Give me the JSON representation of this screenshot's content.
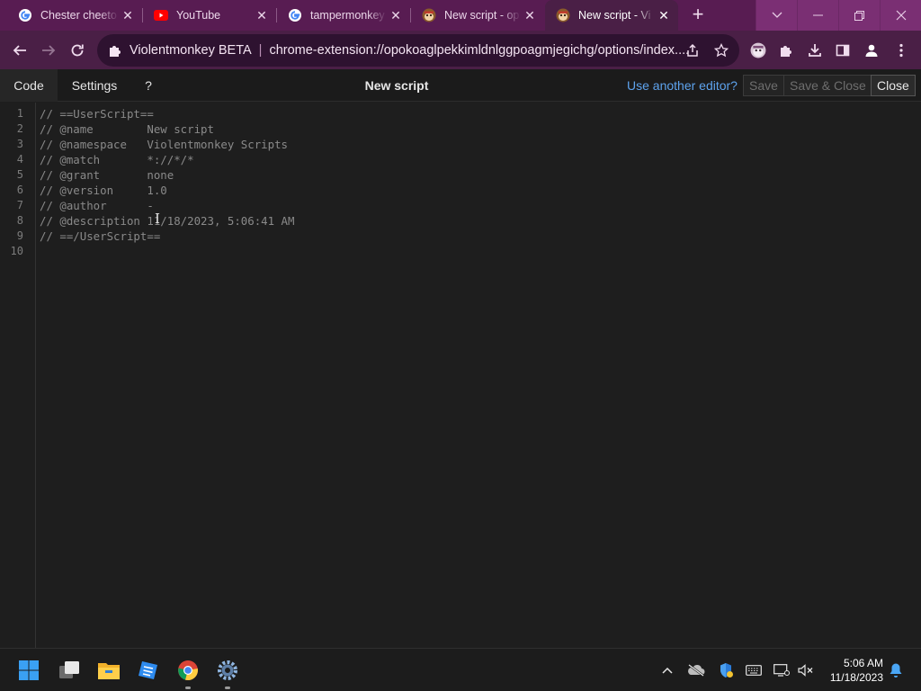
{
  "browser": {
    "tabs": [
      {
        "title": "Chester cheeto",
        "favicon": "google-icon"
      },
      {
        "title": "YouTube",
        "favicon": "youtube-icon"
      },
      {
        "title": "tampermonkey",
        "favicon": "google-icon"
      },
      {
        "title": "New script - op",
        "favicon": "violentmonkey-icon"
      },
      {
        "title": "New script - Vi",
        "favicon": "violentmonkey-icon",
        "active": true
      }
    ],
    "new_tab_label": "+",
    "omnibox": {
      "site_label": "Violentmonkey BETA",
      "url": "chrome-extension://opokoaglpekkimldnlggpoagmjegichg/options/index...."
    },
    "colors": {
      "frame": "#581c52",
      "toolbar": "#4a1f46",
      "omnibox": "#2e1230"
    }
  },
  "app": {
    "tabs": [
      "Code",
      "Settings",
      "?"
    ],
    "active_tab": "Code",
    "title": "New script",
    "another_editor_link": "Use another editor?",
    "buttons": {
      "save": "Save",
      "save_close": "Save & Close",
      "close": "Close"
    },
    "link_color": "#5ea3ee"
  },
  "editor": {
    "line_numbers": [
      "1",
      "2",
      "3",
      "4",
      "5",
      "6",
      "7",
      "8",
      "9",
      "10"
    ],
    "lines": [
      "// ==UserScript==",
      "// @name        New script",
      "// @namespace   Violentmonkey Scripts",
      "// @match       *://*/*",
      "// @grant       none",
      "// @version     1.0",
      "// @author      -",
      "// @description 11/18/2023, 5:06:41 AM",
      "// ==/UserScript==",
      ""
    ]
  },
  "taskbar": {
    "time": "5:06 AM",
    "date": "11/18/2023"
  }
}
